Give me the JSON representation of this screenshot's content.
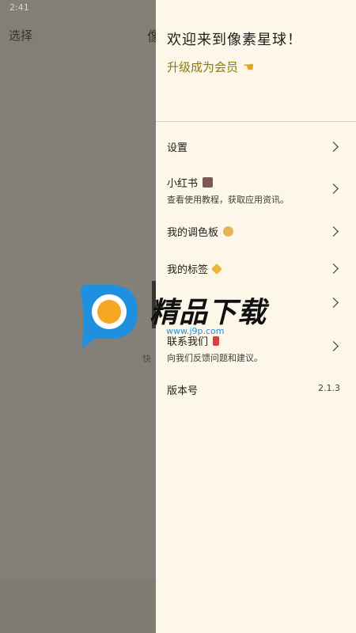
{
  "status_bar": {
    "time": "2:41",
    "icons": [
      "wifi-icon",
      "battery-icon"
    ]
  },
  "background_app": {
    "select_label": "选择",
    "title_fragment": "像",
    "hint_fragment": "快"
  },
  "drawer": {
    "welcome": "欢迎来到像素星球！",
    "upgrade": "升级成为会员",
    "items": [
      {
        "label": "设置"
      },
      {
        "label": "小红书",
        "subtitle": "查看使用教程，获取应用资讯。",
        "icon": "book-icon"
      },
      {
        "label": "我的调色板",
        "icon": "palette-icon"
      },
      {
        "label": "我的标签",
        "icon": "tag-icon"
      },
      {
        "label": ""
      },
      {
        "label": "联系我们",
        "subtitle": "向我们反馈问题和建议。",
        "icon": "mailbox-icon"
      },
      {
        "label": "版本号",
        "value": "2.1.3"
      }
    ]
  },
  "watermark": {
    "text": "精品下载",
    "url": "www.j9p.com"
  },
  "colors": {
    "drawer_bg": "#fdf7ea",
    "accent": "#8a7a10",
    "scrim": "#6f6d66"
  }
}
